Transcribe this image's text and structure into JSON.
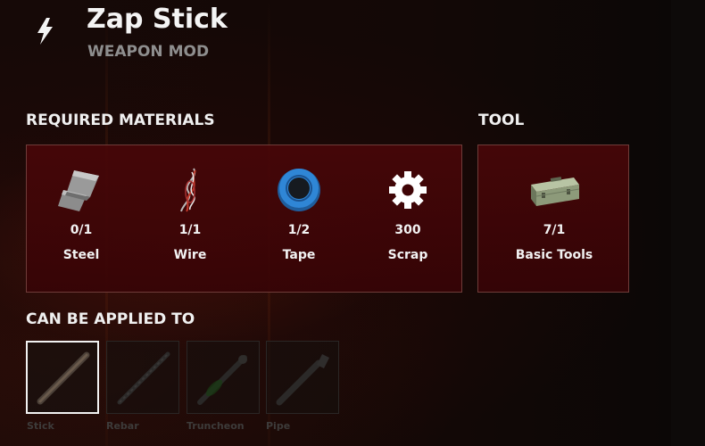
{
  "header": {
    "icon": "lightning-icon",
    "title": "Zap Stick",
    "subtitle": "WEAPON MOD"
  },
  "required_materials": {
    "title": "REQUIRED MATERIALS",
    "items": [
      {
        "icon": "steel-icon",
        "count": "0/1",
        "name": "Steel"
      },
      {
        "icon": "wire-icon",
        "count": "1/1",
        "name": "Wire"
      },
      {
        "icon": "tape-icon",
        "count": "1/2",
        "name": "Tape"
      },
      {
        "icon": "scrap-icon",
        "count": "300",
        "name": "Scrap"
      }
    ]
  },
  "tool": {
    "title": "TOOL",
    "item": {
      "icon": "toolbox-icon",
      "count": "7/1",
      "name": "Basic Tools"
    }
  },
  "applicable": {
    "title": "CAN BE APPLIED TO",
    "weapons": [
      {
        "icon": "stick-icon",
        "label": "Stick",
        "selected": true
      },
      {
        "icon": "rebar-icon",
        "label": "Rebar",
        "selected": false
      },
      {
        "icon": "truncheon-icon",
        "label": "Truncheon",
        "selected": false
      },
      {
        "icon": "pipe-icon",
        "label": "Pipe",
        "selected": false
      }
    ]
  },
  "colors": {
    "panel_bg": "#3f0406",
    "panel_border": "#6f3c39",
    "text_primary": "#f4f4f4",
    "text_secondary": "#8e8e8e",
    "text_disabled": "#3d3b3a",
    "tape_blue": "#2f86d6"
  }
}
